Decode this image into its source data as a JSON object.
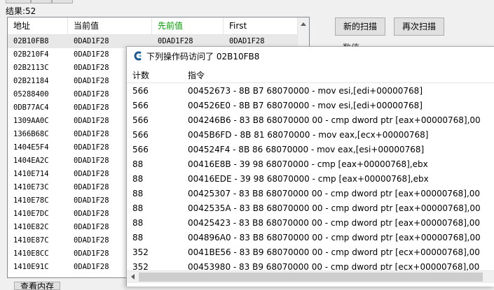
{
  "result": {
    "label": "结果:",
    "count": "52"
  },
  "list": {
    "headers": {
      "address": "地址",
      "current": "当前值",
      "previous": "先前值",
      "first": "First"
    },
    "rows": [
      {
        "address": "02B10FB8",
        "current": "0DAD1F28",
        "previous": "0DAD1F28",
        "first": "0DAD1F28"
      },
      {
        "address": "02B210F4",
        "current": "0DAD1F28"
      },
      {
        "address": "02B2113C",
        "current": "0DAD1F28"
      },
      {
        "address": "02B21184",
        "current": "0DAD1F28"
      },
      {
        "address": "05288400",
        "current": "0DAD1F28"
      },
      {
        "address": "0DB77AC4",
        "current": "0DAD1F28"
      },
      {
        "address": "1309AA0C",
        "current": "0DAD1F28"
      },
      {
        "address": "1366B68C",
        "current": "0DAD1F28"
      },
      {
        "address": "1404E5F4",
        "current": "0DAD1F28"
      },
      {
        "address": "1404EA2C",
        "current": "0DAD1F28"
      },
      {
        "address": "1410E714",
        "current": "0DAD1F28"
      },
      {
        "address": "1410E73C",
        "current": "0DAD1F28"
      },
      {
        "address": "1410E78C",
        "current": "0DAD1F28"
      },
      {
        "address": "1410E7DC",
        "current": "0DAD1F28"
      },
      {
        "address": "1410E82C",
        "current": "0DAD1F28"
      },
      {
        "address": "1410E87C",
        "current": "0DAD1F28"
      },
      {
        "address": "1410E8CC",
        "current": "0DAD1F28"
      },
      {
        "address": "1410E91C",
        "current": "0DAD1F28"
      }
    ]
  },
  "buttons": {
    "new_scan": "新的扫描",
    "next_scan": "再次扫描",
    "bottom": "查看内存"
  },
  "value_label": "数值",
  "popup": {
    "title": "下列操作码访问了 02B10FB8",
    "headers": {
      "count": "计数",
      "instruction": "指令"
    },
    "rows": [
      {
        "count": "566",
        "instruction": "00452673 - 8B B7 68070000  - mov esi,[edi+00000768]"
      },
      {
        "count": "566",
        "instruction": "004526E0 - 8B B7 68070000  - mov esi,[edi+00000768]"
      },
      {
        "count": "566",
        "instruction": "004246B6 - 83 B8 68070000 00 - cmp dword ptr [eax+00000768],00"
      },
      {
        "count": "566",
        "instruction": "0045B6FD - 8B 81 68070000  - mov eax,[ecx+00000768]"
      },
      {
        "count": "566",
        "instruction": "004524F4 - 8B 86 68070000  - mov eax,[esi+00000768]"
      },
      {
        "count": "88",
        "instruction": "00416E8B - 39 98 68070000  - cmp [eax+00000768],ebx"
      },
      {
        "count": "88",
        "instruction": "00416EDE - 39 98 68070000  - cmp [eax+00000768],ebx"
      },
      {
        "count": "88",
        "instruction": "00425307 - 83 B8 68070000 00 - cmp dword ptr [eax+00000768],00"
      },
      {
        "count": "88",
        "instruction": "0042535A - 83 B8 68070000 00 - cmp dword ptr [eax+00000768],00"
      },
      {
        "count": "88",
        "instruction": "00425423 - 83 B8 68070000 00 - cmp dword ptr [eax+00000768],00"
      },
      {
        "count": "88",
        "instruction": "004896A0 - 83 B8 68070000 00 - cmp dword ptr [eax+00000768],00"
      },
      {
        "count": "352",
        "instruction": "0041BE56 - 83 B9 68070000 00 - cmp dword ptr [ecx+00000768],00"
      },
      {
        "count": "352",
        "instruction": "00453980 - 83 B9 68070000 00 - cmp dword ptr [ecx+00000768],00"
      }
    ]
  },
  "colors": {
    "accent_header": "#00a000",
    "selected_row": "#e8e8e8"
  }
}
